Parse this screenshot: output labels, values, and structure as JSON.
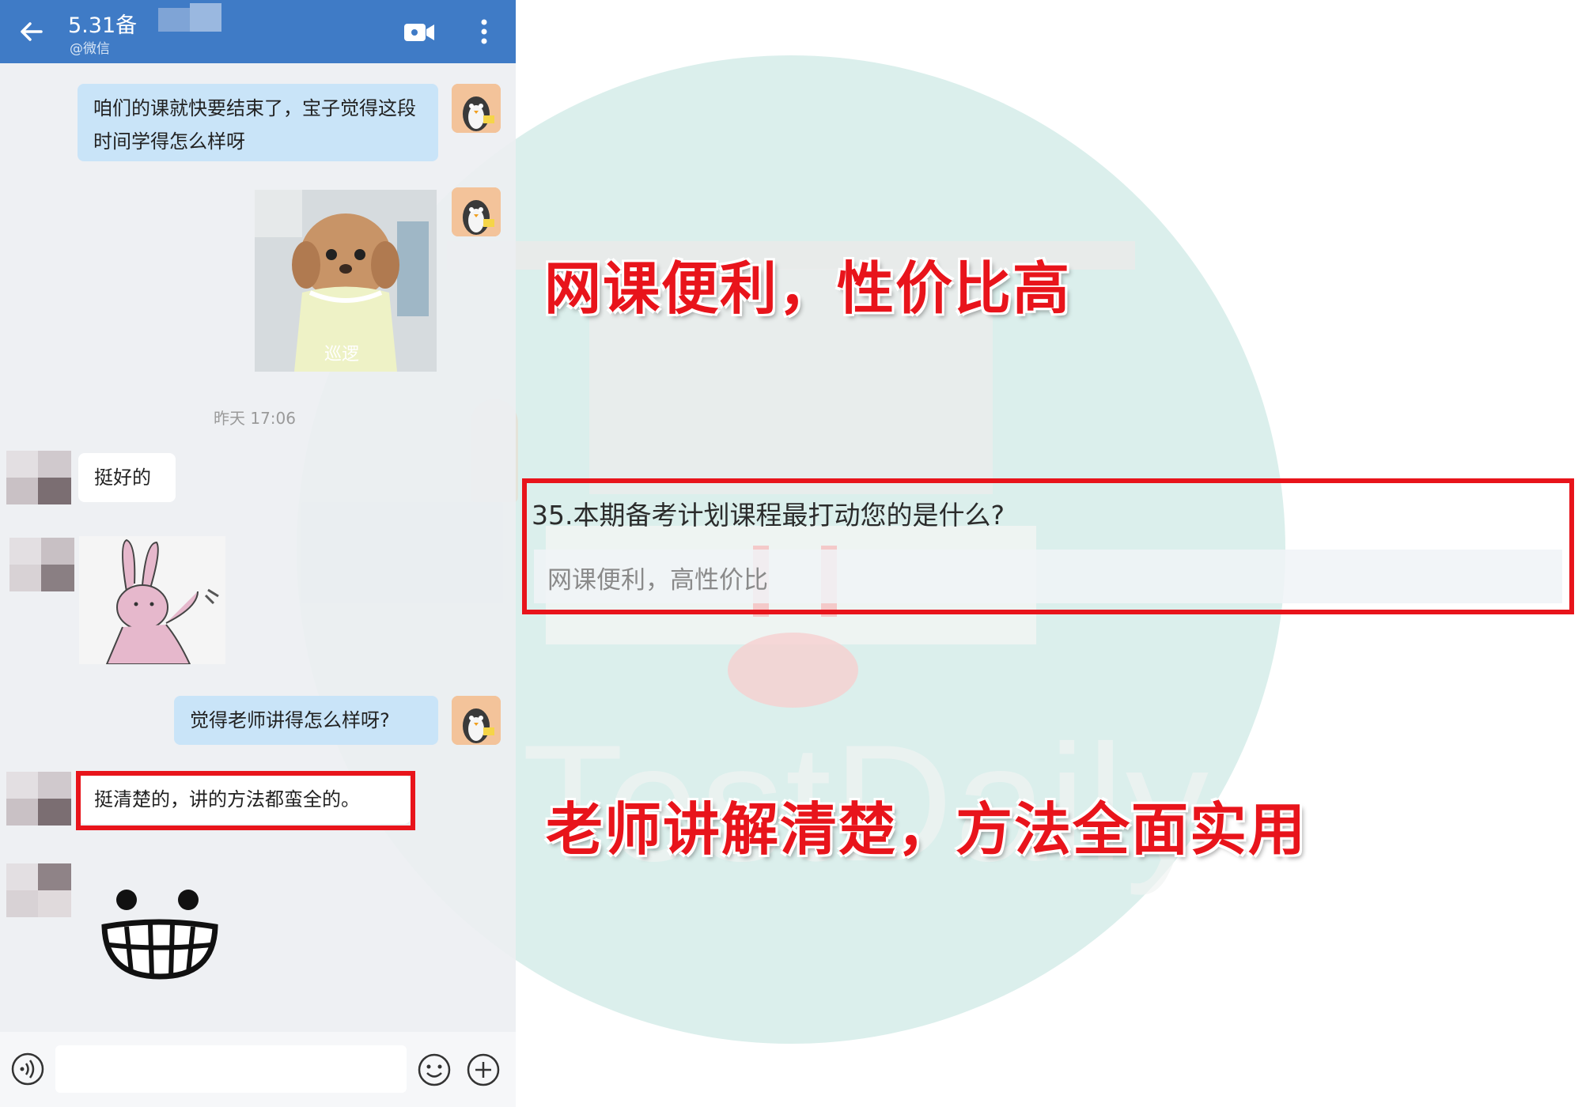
{
  "chat": {
    "title": "5.31备",
    "subtitle": "@微信",
    "messages": [
      {
        "from": "me",
        "text": "咱们的课就快要结束了，宝子觉得这段时间学得怎么样呀"
      },
      {
        "from": "me",
        "type": "sticker",
        "caption": "巡逻"
      },
      {
        "type": "timestamp",
        "text": "昨天 17:06"
      },
      {
        "from": "other",
        "text": "挺好的"
      },
      {
        "from": "other",
        "type": "sticker"
      },
      {
        "from": "me",
        "text": "觉得老师讲得怎么样呀?"
      },
      {
        "from": "other",
        "text": "挺清楚的，讲的方法都蛮全的。"
      },
      {
        "from": "other",
        "type": "sticker"
      }
    ]
  },
  "headlines": {
    "top": "网课便利，性价比高",
    "bottom": "老师讲解清楚，方法全面实用"
  },
  "survey": {
    "question": "35.本期备考计划课程最打动您的是什么?",
    "answer": "网课便利，高性价比"
  },
  "watermark": {
    "text": "TestDaily"
  },
  "colors": {
    "header_blue": "#3f7bc6",
    "my_bubble": "#c9e4f8",
    "highlight_red": "#e8141b"
  }
}
